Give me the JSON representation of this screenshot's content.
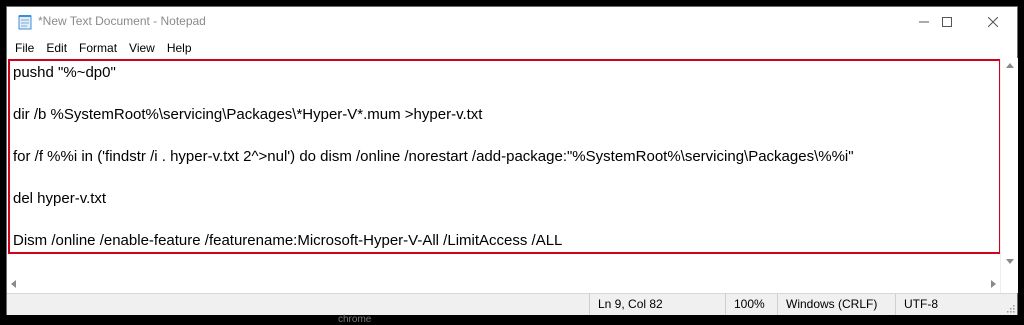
{
  "window": {
    "title": "*New Text Document - Notepad"
  },
  "icons": {
    "app": "notepad-icon",
    "minimize": "minimize-icon",
    "maximize": "maximize-icon",
    "close": "close-icon"
  },
  "menu": {
    "items": [
      "File",
      "Edit",
      "Format",
      "View",
      "Help"
    ]
  },
  "editor": {
    "lines": [
      "pushd \"%~dp0\"",
      "",
      "dir /b %SystemRoot%\\servicing\\Packages\\*Hyper-V*.mum >hyper-v.txt",
      "",
      "for /f %%i in ('findstr /i . hyper-v.txt 2^>nul') do dism /online /norestart /add-package:\"%SystemRoot%\\servicing\\Packages\\%%i\"",
      "",
      "del hyper-v.txt",
      "",
      "Dism /online /enable-feature /featurename:Microsoft-Hyper-V-All /LimitAccess /ALL"
    ]
  },
  "annotation": {
    "highlight_color": "#d0021b"
  },
  "status": {
    "position": "Ln 9, Col 82",
    "zoom": "100%",
    "line_ending": "Windows (CRLF)",
    "encoding": "UTF-8"
  },
  "background": {
    "peek_text": "chrome"
  }
}
